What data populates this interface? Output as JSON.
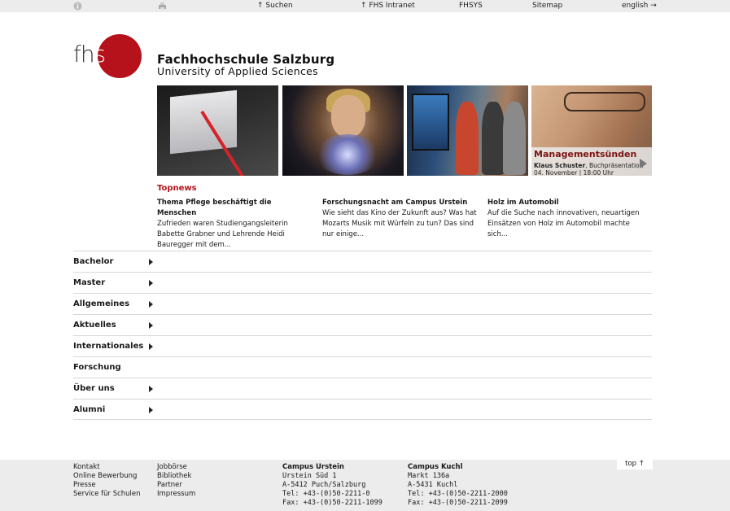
{
  "topbar": {
    "search": "↑ Suchen",
    "intranet": "↑ FHS Intranet",
    "fhsys": "FHSYS",
    "sitemap": "Sitemap",
    "lang": "english →"
  },
  "brand": {
    "logo_l1": "fh",
    "logo_l2": "s",
    "title": "Fachhochschule Salzburg",
    "subtitle": "University of Applied Sciences",
    "accent": "#b5121b"
  },
  "banner": {
    "title": "Managementsünden",
    "author": "Klaus Schuster",
    "author_rest": ", Buchpräsentation",
    "date": "04. November | 18:00 Uhr"
  },
  "topnews": {
    "heading": "Topnews",
    "items": [
      {
        "title": "Thema Pflege beschäftigt die Menschen",
        "text": "Zufrieden waren Studiengangsleiterin Babette Grabner und Lehrende Heidi Bauregger mit dem..."
      },
      {
        "title": "Forschungsnacht am Campus Urstein",
        "text": "Wie sieht das Kino der Zukunft aus? Was hat Mozarts Musik mit Würfeln zu tun? Das sind nur einige..."
      },
      {
        "title": "Holz im Automobil",
        "text": "Auf die Suche nach innovativen, neuartigen Einsätzen von Holz im Automobil machte sich..."
      }
    ]
  },
  "nav": [
    {
      "label": "Bachelor",
      "arrow": true
    },
    {
      "label": "Master",
      "arrow": true
    },
    {
      "label": "Allgemeines",
      "arrow": true
    },
    {
      "label": "Aktuelles",
      "arrow": true
    },
    {
      "label": "Internationales",
      "arrow": true
    },
    {
      "label": "Forschung",
      "arrow": false
    },
    {
      "label": "Über uns",
      "arrow": true
    },
    {
      "label": "Alumni",
      "arrow": true
    }
  ],
  "footer": {
    "col1": [
      "Kontakt",
      "Online Bewerbung",
      "Presse",
      "Service für Schulen"
    ],
    "col2": [
      "Jobbörse",
      "Bibliothek",
      "Partner",
      "Impressum"
    ],
    "urstein": {
      "heading": "Campus Urstein",
      "street": "Urstein Süd 1",
      "city": "A-5412 Puch/Salzburg",
      "tel": "Tel: +43-(0)50-2211-0",
      "fax": "Fax: +43-(0)50-2211-1099"
    },
    "kuchl": {
      "heading": "Campus Kuchl",
      "street": "Markt 136a",
      "city": "A-5431 Kuchl",
      "tel": "Tel: +43-(0)50-2211-2000",
      "fax": "Fax: +43-(0)50-2211-2099"
    },
    "top": "top ↑"
  }
}
